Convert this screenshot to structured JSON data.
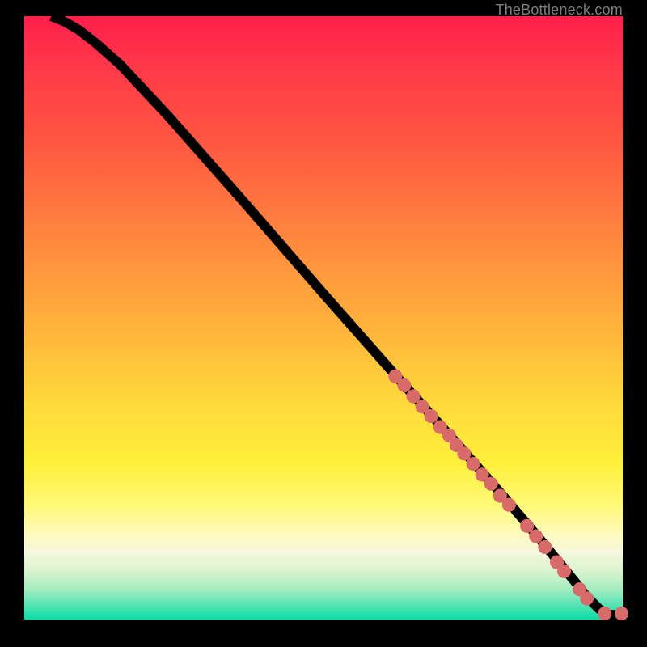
{
  "attribution": "TheBottleneck.com",
  "chart_data": {
    "type": "line",
    "title": "",
    "xlabel": "",
    "ylabel": "",
    "xlim": [
      0,
      100
    ],
    "ylim": [
      0,
      100
    ],
    "curve": [
      {
        "x": 4.5,
        "y": 100
      },
      {
        "x": 6.5,
        "y": 99.2
      },
      {
        "x": 9,
        "y": 97.8
      },
      {
        "x": 12,
        "y": 95.5
      },
      {
        "x": 16,
        "y": 92
      },
      {
        "x": 24,
        "y": 83.5
      },
      {
        "x": 36,
        "y": 70
      },
      {
        "x": 50,
        "y": 54
      },
      {
        "x": 62,
        "y": 40.5
      },
      {
        "x": 72,
        "y": 29.5
      },
      {
        "x": 80,
        "y": 20.5
      },
      {
        "x": 86,
        "y": 13.5
      },
      {
        "x": 91,
        "y": 7.5
      },
      {
        "x": 94,
        "y": 3.8
      },
      {
        "x": 96,
        "y": 1.8
      },
      {
        "x": 97.5,
        "y": 0.8
      },
      {
        "x": 100,
        "y": 0.8
      }
    ],
    "dot_cluster_1": [
      {
        "x": 62,
        "y": 40.3
      },
      {
        "x": 63.5,
        "y": 38.8
      },
      {
        "x": 65,
        "y": 37
      },
      {
        "x": 66.5,
        "y": 35.3
      },
      {
        "x": 68,
        "y": 33.7
      },
      {
        "x": 69.5,
        "y": 31.9
      },
      {
        "x": 71,
        "y": 30.5
      },
      {
        "x": 72.2,
        "y": 28.9
      }
    ],
    "dot_cluster_2": [
      {
        "x": 73.5,
        "y": 27.5
      },
      {
        "x": 75,
        "y": 25.8
      },
      {
        "x": 76.5,
        "y": 24
      },
      {
        "x": 78,
        "y": 22.5
      },
      {
        "x": 79.5,
        "y": 20.5
      },
      {
        "x": 81,
        "y": 19
      }
    ],
    "dot_cluster_3": [
      {
        "x": 84,
        "y": 15.5
      },
      {
        "x": 85.5,
        "y": 13.8
      },
      {
        "x": 87,
        "y": 12
      }
    ],
    "dot_cluster_4": [
      {
        "x": 89,
        "y": 9.5
      },
      {
        "x": 90.2,
        "y": 8
      }
    ],
    "dot_cluster_5": [
      {
        "x": 92.8,
        "y": 5
      },
      {
        "x": 94,
        "y": 3.5
      }
    ],
    "dot_tail": [
      {
        "x": 97,
        "y": 1
      },
      {
        "x": 99.8,
        "y": 1
      }
    ]
  }
}
